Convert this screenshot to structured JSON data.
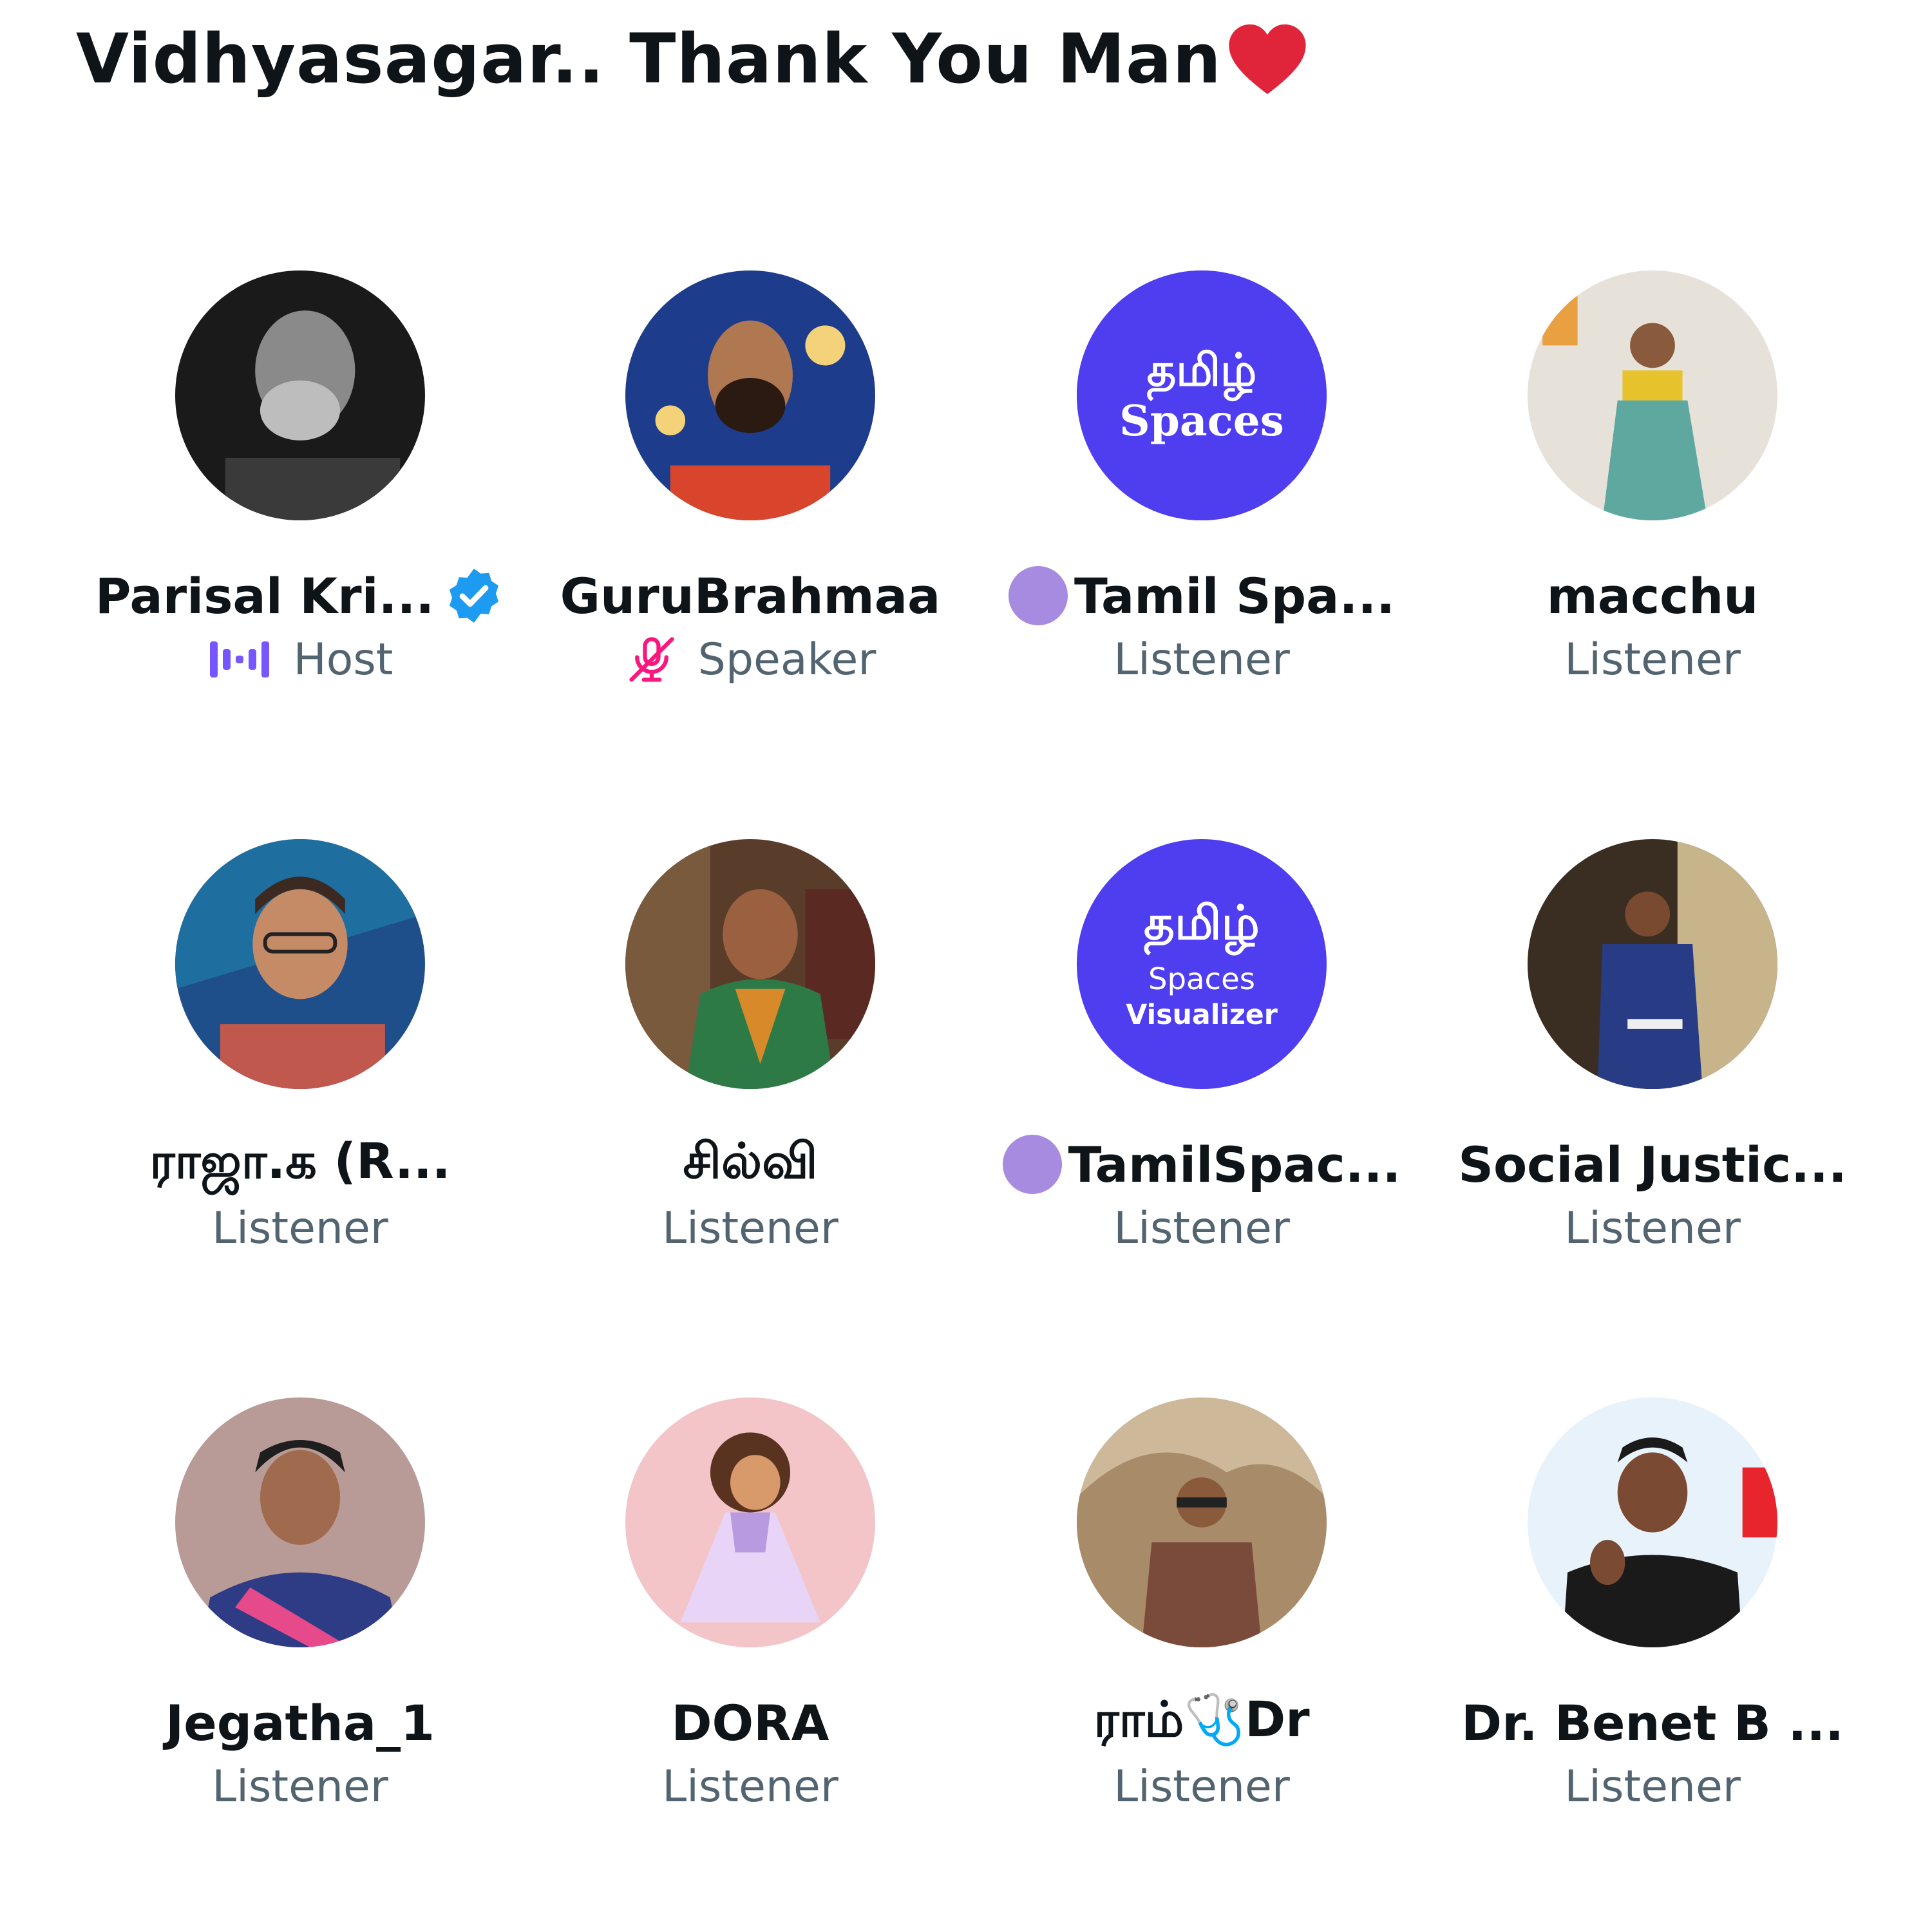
{
  "space": {
    "title": "Vidhyasagar.. Thank You Man"
  },
  "participants": [
    {
      "name": "Parisal Kri...",
      "role": "Host"
    },
    {
      "name": "GuruBrahmaa",
      "role": "Speaker"
    },
    {
      "name": "Tamil Spa...",
      "role": "Listener",
      "avatar_text": [
        "தமிழ்",
        "Spaces"
      ]
    },
    {
      "name": "macchu",
      "role": "Listener"
    },
    {
      "name": "ராஜா.க (R...",
      "role": "Listener"
    },
    {
      "name": "சில்வி",
      "role": "Listener"
    },
    {
      "name": "TamilSpac...",
      "role": "Listener",
      "avatar_text": [
        "தமிழ்",
        "Spaces",
        "Visualizer"
      ]
    },
    {
      "name": "Social Justic...",
      "role": "Listener"
    },
    {
      "name": "Jegatha_1",
      "role": "Listener"
    },
    {
      "name": "DORA",
      "role": "Listener"
    },
    {
      "name": "ராம்🩺Dr",
      "role": "Listener"
    },
    {
      "name": "Dr. Benet B ...",
      "role": "Listener"
    }
  ],
  "icons": {
    "title_emoji": "heart-icon",
    "host_indicator": "audio-waveform-icon",
    "speaker_indicator": "microphone-muted-icon",
    "verified": "verified-badge-icon",
    "community_badge": "purple-dot-icon"
  },
  "colors": {
    "host_icon": "#7856ff",
    "muted_mic": "#f91880",
    "verified": "#1d9bf0",
    "badge_dot": "#a78be0",
    "role_text": "#536471",
    "spaces_avatar": "#4f3df0",
    "heart": "#e0243a"
  }
}
